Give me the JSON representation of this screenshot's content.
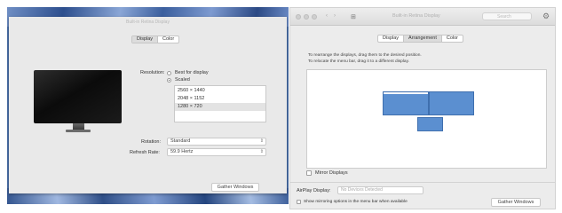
{
  "left_window": {
    "title": "Built-in Retina Display",
    "tabs": [
      {
        "label": "Display"
      },
      {
        "label": "Color"
      }
    ],
    "resolution_label": "Resolution:",
    "resolution_options": [
      {
        "label": "Best for display"
      },
      {
        "label": "Scaled"
      }
    ],
    "resolution_list": [
      "2560 × 1440",
      "2048 × 1152",
      "1280 × 720"
    ],
    "rotation_label": "Rotation:",
    "rotation_value": "Standard",
    "refresh_label": "Refresh Rate:",
    "refresh_value": "59.9 Hertz",
    "gather_label": "Gather Windows"
  },
  "right_window": {
    "title": "Built-in Retina Display",
    "search_placeholder": "Search",
    "tabs": [
      {
        "label": "Display"
      },
      {
        "label": "Arrangement"
      },
      {
        "label": "Color"
      }
    ],
    "instruction_line1": "To rearrange the displays, drag them to the desired position.",
    "instruction_line2": "To relocate the menu bar, drag it to a different display.",
    "mirror_label": "Mirror Displays",
    "airplay_label": "AirPlay Display:",
    "airplay_value": "No Devices Detected",
    "show_mirroring_label": "Show mirroring options in the menu bar when available",
    "gather_label": "Gather Windows"
  },
  "colors": {
    "display_fill": "#5b8fd0",
    "display_border": "#3f6fae",
    "window_bg": "#ececec"
  }
}
